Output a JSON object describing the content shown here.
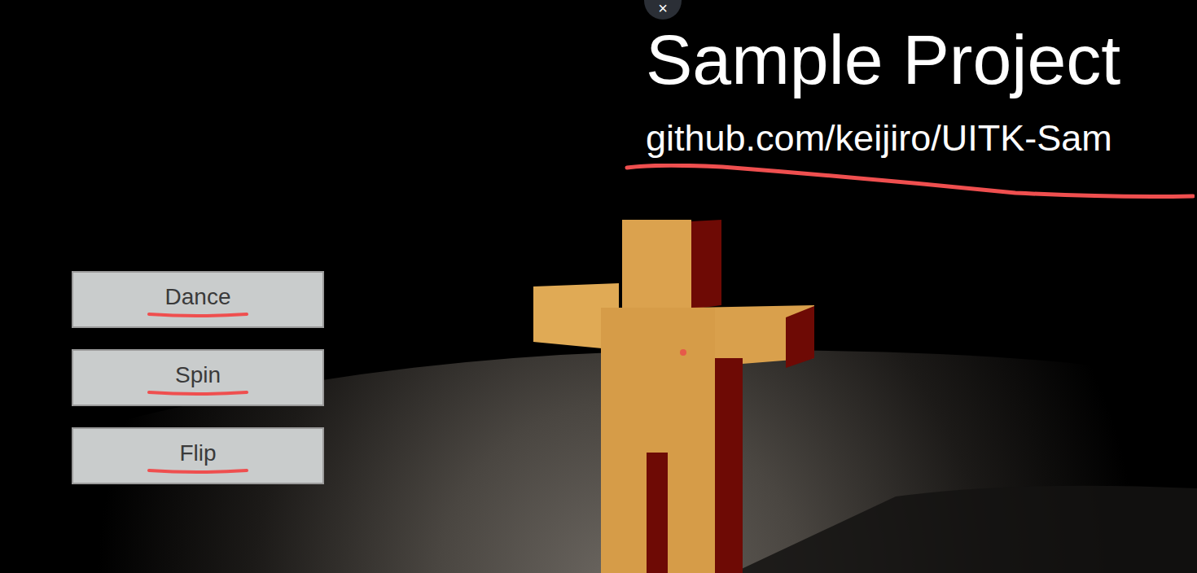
{
  "close_button": {
    "label": "×"
  },
  "slide": {
    "title": "Sample Project",
    "url": "github.com/keijiro/UITK-Sam",
    "url_underlined": true
  },
  "buttons": [
    {
      "label": "Dance",
      "underlined": true
    },
    {
      "label": "Spin",
      "underlined": true
    },
    {
      "label": "Flip",
      "underlined": true
    }
  ]
}
